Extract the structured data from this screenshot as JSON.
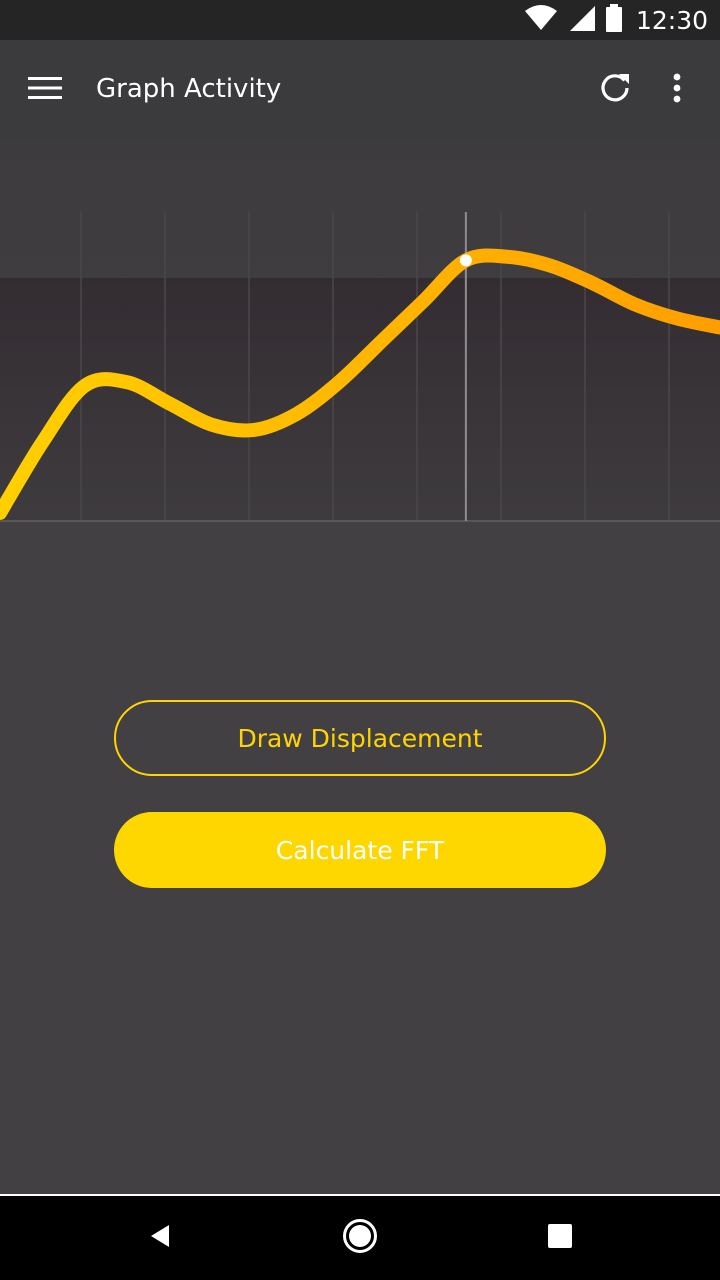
{
  "status_bar": {
    "time": "12:30",
    "icons": [
      "wifi-icon",
      "cell-signal-icon",
      "battery-icon"
    ]
  },
  "app_bar": {
    "title": "Graph Activity",
    "icons": [
      "menu-icon",
      "refresh-icon",
      "more-vert-icon"
    ]
  },
  "chart_data": {
    "type": "line",
    "x": [
      0,
      1,
      2,
      3,
      4,
      5,
      6,
      7,
      8,
      9,
      10,
      11,
      12,
      13,
      14,
      15,
      16,
      17
    ],
    "values": [
      0.0,
      0.4,
      0.72,
      0.74,
      0.62,
      0.5,
      0.47,
      0.56,
      0.74,
      0.97,
      1.2,
      1.43,
      1.45,
      1.4,
      1.3,
      1.18,
      1.1,
      1.05
    ],
    "highlight_index": 11,
    "series_color": "#ffb300",
    "series_color_start": "#ffd000",
    "series_color_end": "#ff9e00",
    "grid": true
  },
  "buttons": {
    "draw_displacement": "Draw Displacement",
    "calculate_fft": "Calculate FFT"
  },
  "nav_bar": {
    "icons": [
      "back-icon",
      "home-icon",
      "recents-icon"
    ]
  },
  "colors": {
    "background": "#424042",
    "app_bar": "#3b3b3d",
    "accent": "#ffd700"
  }
}
